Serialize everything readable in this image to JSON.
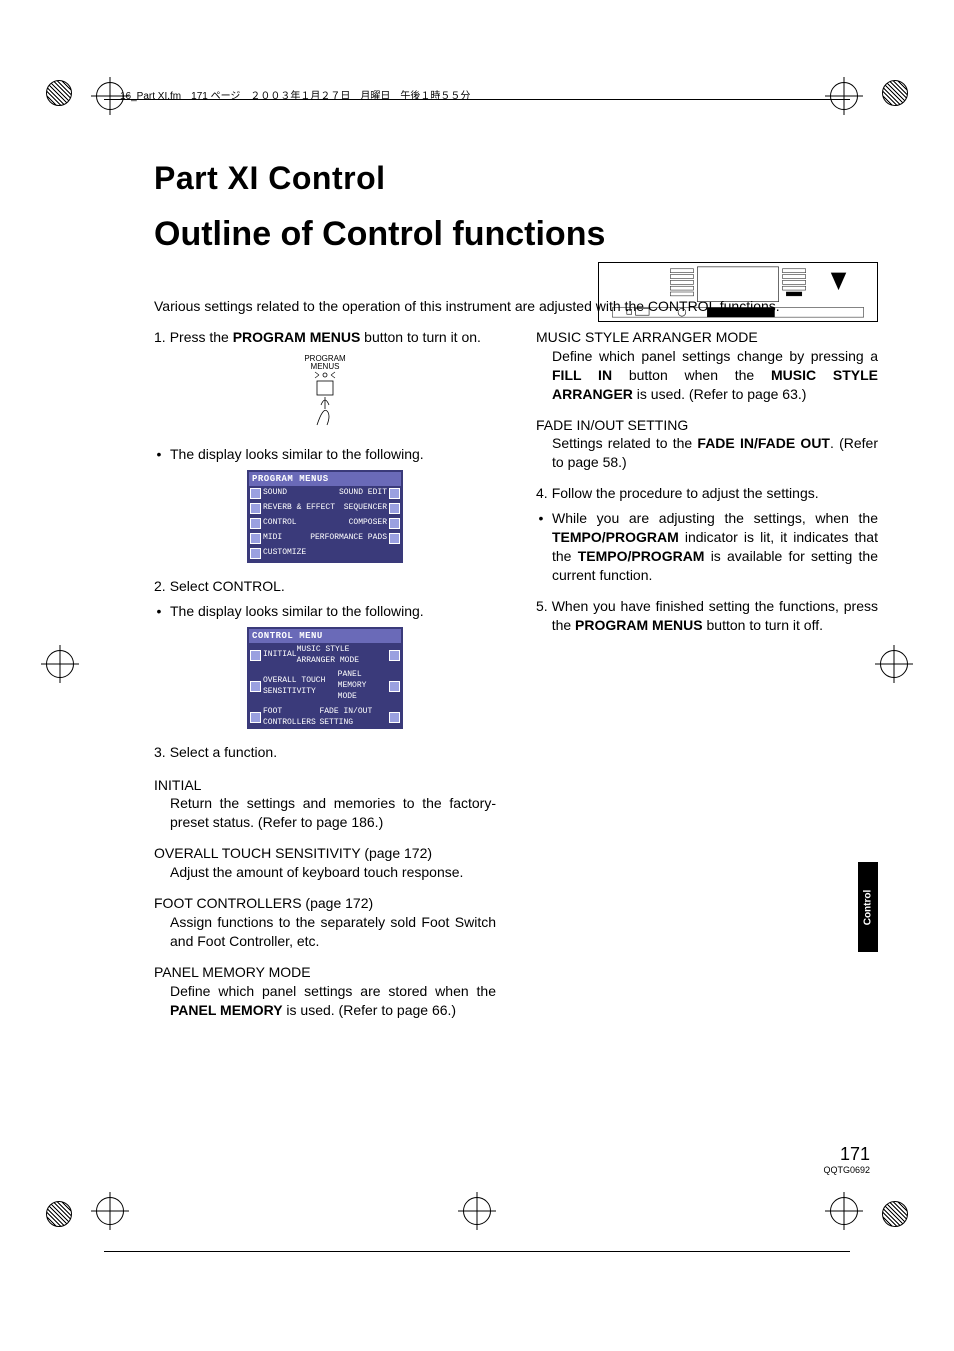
{
  "header_info": "16_Part XI.fm　171 ページ　２００３年１月２７日　月曜日　午後１時５５分",
  "part_title": "Part XI    Control",
  "section_title": "Outline of Control functions",
  "intro": "Various settings related to the operation of this instrument are adjusted with the CONTROL functions.",
  "left": {
    "step1_num": "1.",
    "step1a": "Press the ",
    "step1_bold": "PROGRAM MENUS",
    "step1b": " button to turn it on.",
    "pm_label1": "PROGRAM",
    "pm_label2": "MENUS",
    "display_note": "The display looks similar to the following.",
    "screen1_title": "PROGRAM MENUS",
    "screen1_left": [
      "SOUND",
      "REVERB & EFFECT",
      "CONTROL",
      "MIDI",
      "CUSTOMIZE"
    ],
    "screen1_right": [
      "SOUND EDIT",
      "SEQUENCER",
      "COMPOSER",
      "PERFORMANCE PADS"
    ],
    "step2_num": "2.",
    "step2": "Select CONTROL.",
    "display_note2": "The display looks similar to the following.",
    "screen2_title": "CONTROL MENU",
    "screen2_left": [
      "INITIAL",
      "OVERALL TOUCH SENSITIVITY",
      "FOOT CONTROLLERS"
    ],
    "screen2_right": [
      "MUSIC STYLE ARRANGER MODE",
      "PANEL MEMORY MODE",
      "FADE IN/OUT SETTING"
    ],
    "step3_num": "3.",
    "step3": "Select a function.",
    "func_initial_title": "INITIAL",
    "func_initial_body": "Return the settings and memories to the factory-preset status. (Refer to page 186.)",
    "func_ots_title": "OVERALL TOUCH SENSITIVITY (page 172)",
    "func_ots_body": "Adjust the amount of keyboard touch response.",
    "func_foot_title": "FOOT CONTROLLERS (page 172)",
    "func_foot_body": "Assign functions to the separately sold Foot Switch and Foot Controller, etc.",
    "func_pmm_title": "PANEL MEMORY MODE",
    "func_pmm_body_a": "Define which panel settings are stored when the ",
    "func_pmm_bold": "PANEL MEMORY",
    "func_pmm_body_b": " is used. (Refer to page 66.)"
  },
  "right": {
    "func_msam_title": "MUSIC STYLE ARRANGER MODE",
    "func_msam_a": "Define which panel settings change by pressing a ",
    "func_msam_bold1": "FILL IN",
    "func_msam_b": " button when the ",
    "func_msam_bold2": "MUSIC STYLE ARRANGER",
    "func_msam_c": " is used. (Refer to page 63.)",
    "func_fio_title": "FADE IN/OUT SETTING",
    "func_fio_a": "Settings related to the ",
    "func_fio_bold": "FADE IN/FADE OUT",
    "func_fio_b": ". (Refer to page 58.)",
    "step4_num": "4.",
    "step4": "Follow the procedure to adjust the settings.",
    "step4_bullet_a": "While you are adjusting the settings, when the ",
    "step4_bullet_bold1": "TEMPO/PROGRAM",
    "step4_bullet_b": " indicator is lit, it indicates that the ",
    "step4_bullet_bold2": "TEMPO/PROGRAM",
    "step4_bullet_c": " is available for setting the current function.",
    "step5_num": "5.",
    "step5a": "When you have finished setting the functions, press the ",
    "step5_bold": "PROGRAM MENUS",
    "step5b": " button to turn it off."
  },
  "side_tab": "Control",
  "page_number": "171",
  "doc_code": "QQTG0692"
}
